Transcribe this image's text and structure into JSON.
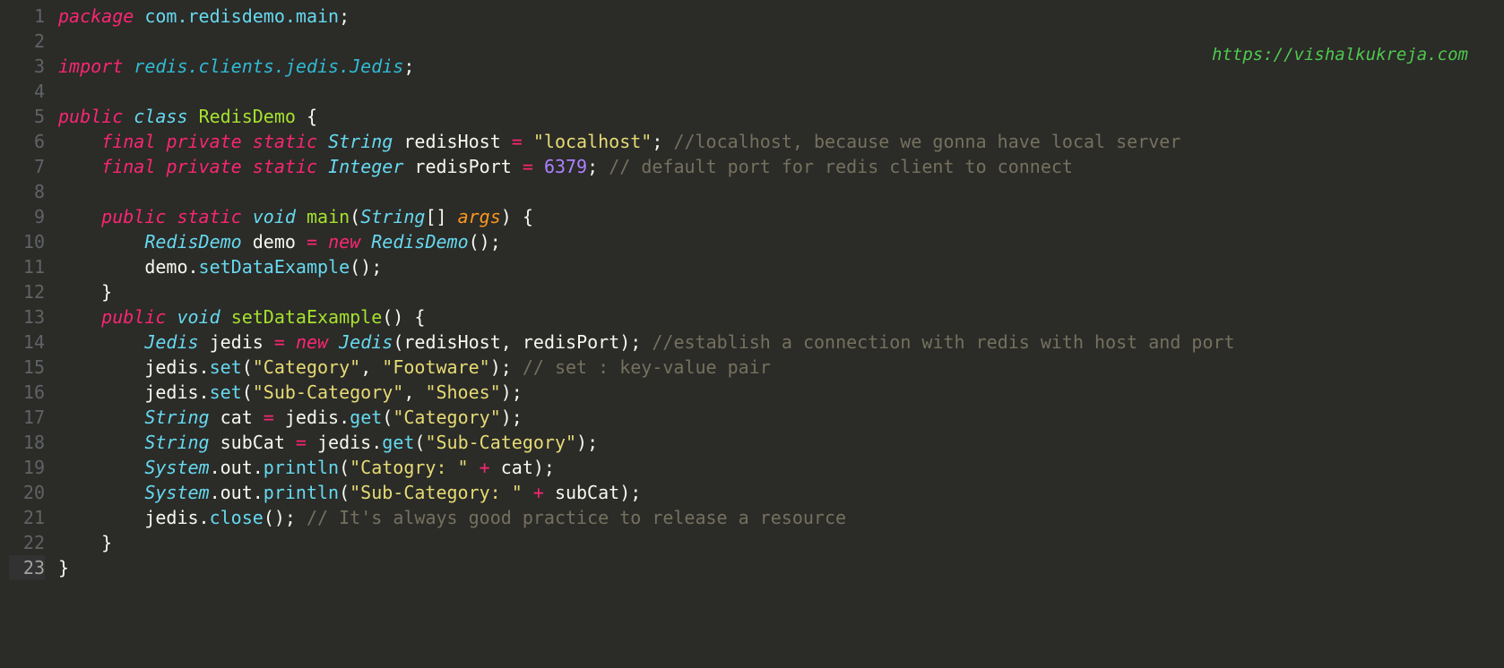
{
  "watermark": "https://vishalkukreja.com",
  "line_numbers": [
    "1",
    "2",
    "3",
    "4",
    "5",
    "6",
    "7",
    "8",
    "9",
    "10",
    "11",
    "12",
    "13",
    "14",
    "15",
    "16",
    "17",
    "18",
    "19",
    "20",
    "21",
    "22",
    "23"
  ],
  "code": {
    "l1": {
      "kw_package": "package",
      "pkg": "com.redisdemo.main",
      "semi": ";"
    },
    "l3": {
      "kw_import": "import",
      "pkg": "redis.clients.jedis.Jedis",
      "semi": ";"
    },
    "l5": {
      "kw_public": "public",
      "kw_class": "class",
      "name": "RedisDemo",
      "brace": "{"
    },
    "l6": {
      "kw_final": "final",
      "kw_private": "private",
      "kw_static": "static",
      "type": "String",
      "field": "redisHost",
      "op": "=",
      "str": "\"localhost\"",
      "semi": ";",
      "comment": "//localhost, because we gonna have local server"
    },
    "l7": {
      "kw_final": "final",
      "kw_private": "private",
      "kw_static": "static",
      "type": "Integer",
      "field": "redisPort",
      "op": "=",
      "num": "6379",
      "semi": ";",
      "comment": "// default port for redis client to connect"
    },
    "l9": {
      "kw_public": "public",
      "kw_static": "static",
      "type": "void",
      "method": "main",
      "lparen": "(",
      "ptype": "String",
      "brackets": "[]",
      "param": "args",
      "rparen": ")",
      "brace": "{"
    },
    "l10": {
      "type": "RedisDemo",
      "var": "demo",
      "op": "=",
      "kw_new": "new",
      "ctor": "RedisDemo",
      "parens": "()",
      "semi": ";"
    },
    "l11": {
      "var": "demo",
      "dot": ".",
      "method": "setDataExample",
      "parens": "()",
      "semi": ";"
    },
    "l12": {
      "brace": "}"
    },
    "l13": {
      "kw_public": "public",
      "type": "void",
      "method": "setDataExample",
      "parens": "()",
      "brace": "{"
    },
    "l14": {
      "type": "Jedis",
      "var": "jedis",
      "op": "=",
      "kw_new": "new",
      "ctor": "Jedis",
      "lparen": "(",
      "arg1": "redisHost",
      "comma": ",",
      "arg2": "redisPort",
      "rparen": ")",
      "semi": ";",
      "comment": "//establish a connection with redis with host and port"
    },
    "l15": {
      "var": "jedis",
      "dot": ".",
      "method": "set",
      "lparen": "(",
      "str1": "\"Category\"",
      "comma": ",",
      "str2": "\"Footware\"",
      "rparen": ")",
      "semi": ";",
      "comment": "// set : key-value pair"
    },
    "l16": {
      "var": "jedis",
      "dot": ".",
      "method": "set",
      "lparen": "(",
      "str1": "\"Sub-Category\"",
      "comma": ",",
      "str2": "\"Shoes\"",
      "rparen": ")",
      "semi": ";"
    },
    "l17": {
      "type": "String",
      "var": "cat",
      "op": "=",
      "obj": "jedis",
      "dot": ".",
      "method": "get",
      "lparen": "(",
      "str": "\"Category\"",
      "rparen": ")",
      "semi": ";"
    },
    "l18": {
      "type": "String",
      "var": "subCat",
      "op": "=",
      "obj": "jedis",
      "dot": ".",
      "method": "get",
      "lparen": "(",
      "str": "\"Sub-Category\"",
      "rparen": ")",
      "semi": ";"
    },
    "l19": {
      "type": "System",
      "dot1": ".",
      "out": "out",
      "dot2": ".",
      "method": "println",
      "lparen": "(",
      "str": "\"Catogry: \"",
      "op": "+",
      "var": "cat",
      "rparen": ")",
      "semi": ";"
    },
    "l20": {
      "type": "System",
      "dot1": ".",
      "out": "out",
      "dot2": ".",
      "method": "println",
      "lparen": "(",
      "str": "\"Sub-Category: \"",
      "op": "+",
      "var": "subCat",
      "rparen": ")",
      "semi": ";"
    },
    "l21": {
      "var": "jedis",
      "dot": ".",
      "method": "close",
      "parens": "()",
      "semi": ";",
      "comment": "// It's always good practice to release a resource"
    },
    "l22": {
      "brace": "}"
    },
    "l23": {
      "brace": "}"
    }
  }
}
